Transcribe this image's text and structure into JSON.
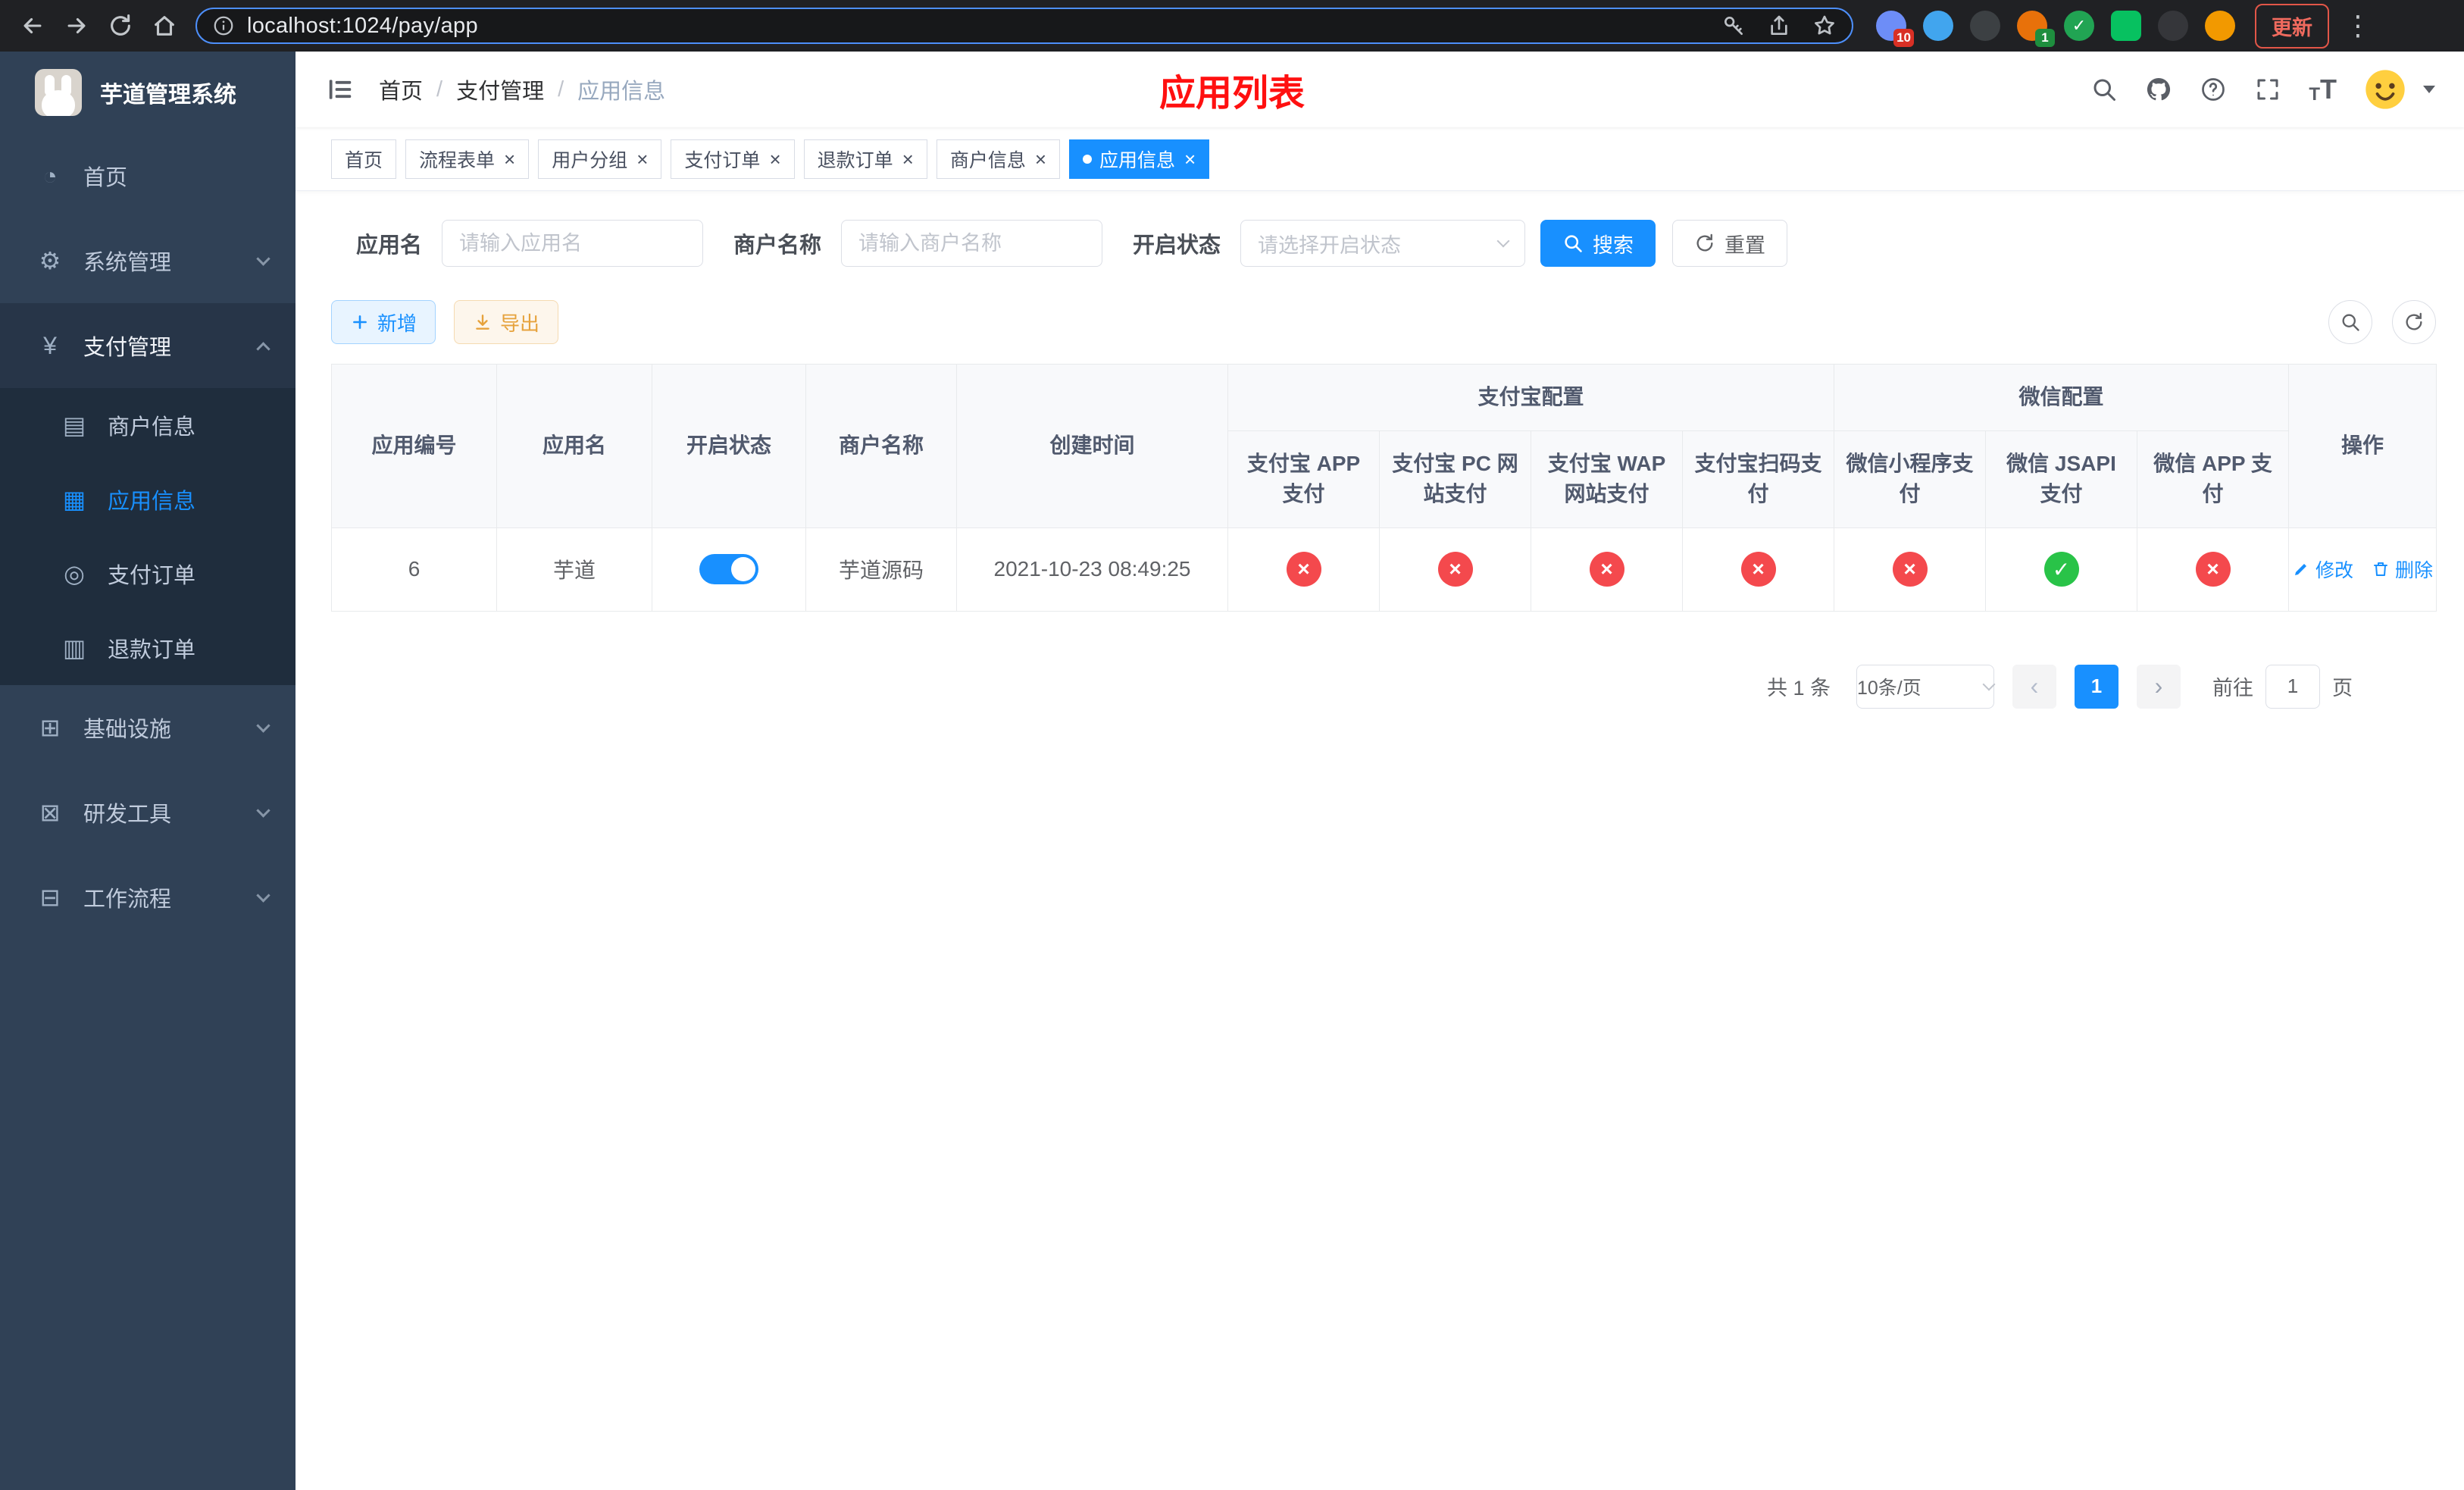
{
  "colors": {
    "accent": "#1890ff",
    "title_red": "#ff1010",
    "config_disabled": "#f4494d",
    "config_enabled": "#29c348"
  },
  "browser": {
    "url": "localhost:1024/pay/app",
    "update_label": "更新",
    "extensions": [
      {
        "name": "puzzle-extension-icon",
        "color": "#6d8df7",
        "badge": "10",
        "badge_color": "#d93025",
        "shape": "circle"
      },
      {
        "name": "droplet-extension-icon",
        "color": "#41a5ee",
        "shape": "circle"
      },
      {
        "name": "dark-sphere-extension-icon",
        "color": "#3c4043",
        "shape": "circle"
      },
      {
        "name": "colorful-extension-icon",
        "color": "#e8710a",
        "badge": "1",
        "badge_color": "#1e8e3e",
        "shape": "circle"
      },
      {
        "name": "green-check-extension-icon",
        "color": "#21a453",
        "glyph": "✓",
        "shape": "circle"
      },
      {
        "name": "green-square-extension-icon",
        "color": "#07c160",
        "shape": "square"
      },
      {
        "name": "dark-puzzle-extension-icon",
        "color": "#35363a",
        "shape": "circle"
      },
      {
        "name": "orange-face-extension-icon",
        "color": "#f29900",
        "shape": "circle"
      }
    ]
  },
  "sidebar": {
    "logo_title": "芋道管理系统",
    "items": [
      {
        "key": "home",
        "label": "首页",
        "icon": "dashboard-icon"
      },
      {
        "key": "system-management",
        "label": "系统管理",
        "icon": "gear-icon",
        "group": true
      },
      {
        "key": "payment-management",
        "label": "支付管理",
        "icon": "yen-icon",
        "group": true,
        "expanded": true,
        "children": [
          {
            "key": "merchant-info",
            "label": "商户信息",
            "icon": "bank-card-icon"
          },
          {
            "key": "app-info",
            "label": "应用信息",
            "icon": "grid-icon",
            "active": true
          },
          {
            "key": "payment-orders",
            "label": "支付订单",
            "icon": "order-icon"
          },
          {
            "key": "refund-orders",
            "label": "退款订单",
            "icon": "document-icon"
          }
        ]
      },
      {
        "key": "infrastructure",
        "label": "基础设施",
        "icon": "infra-icon",
        "group": true
      },
      {
        "key": "dev-tools",
        "label": "研发工具",
        "icon": "tools-icon",
        "group": true
      },
      {
        "key": "workflow",
        "label": "工作流程",
        "icon": "workflow-icon",
        "group": true
      }
    ]
  },
  "header": {
    "breadcrumb": [
      "首页",
      "支付管理",
      "应用信息"
    ],
    "page_title": "应用列表"
  },
  "tabs": [
    {
      "label": "首页",
      "closable": false,
      "active": false
    },
    {
      "label": "流程表单",
      "closable": true,
      "active": false
    },
    {
      "label": "用户分组",
      "closable": true,
      "active": false
    },
    {
      "label": "支付订单",
      "closable": true,
      "active": false
    },
    {
      "label": "退款订单",
      "closable": true,
      "active": false
    },
    {
      "label": "商户信息",
      "closable": true,
      "active": false
    },
    {
      "label": "应用信息",
      "closable": true,
      "active": true
    }
  ],
  "filters": {
    "app_name_label": "应用名",
    "app_name_placeholder": "请输入应用名",
    "merchant_label": "商户名称",
    "merchant_placeholder": "请输入商户名称",
    "status_label": "开启状态",
    "status_placeholder": "请选择开启状态",
    "search_label": "搜索",
    "reset_label": "重置"
  },
  "toolbar": {
    "add_label": "新增",
    "export_label": "导出"
  },
  "table": {
    "plain_headers": [
      "应用编号",
      "应用名",
      "开启状态",
      "商户名称",
      "创建时间"
    ],
    "groups": [
      {
        "label": "支付宝配置",
        "columns": [
          "支付宝 APP 支付",
          "支付宝 PC 网站支付",
          "支付宝 WAP 网站支付",
          "支付宝扫码支付"
        ]
      },
      {
        "label": "微信配置",
        "columns": [
          "微信小程序支付",
          "微信 JSAPI 支付",
          "微信 APP 支付"
        ]
      }
    ],
    "action_header": "操作",
    "rows": [
      {
        "app_id": "6",
        "app_name": "芋道",
        "status_enabled": true,
        "merchant_name": "芋道源码",
        "created_at": "2021-10-23 08:49:25",
        "pay_configs": [
          false,
          false,
          false,
          false,
          false,
          true,
          false
        ],
        "edit_label": "修改",
        "delete_label": "删除"
      }
    ]
  },
  "pagination": {
    "total_text": "共 1 条",
    "page_size": "10条/页",
    "current_page": "1",
    "goto_label": "前往",
    "goto_value": "1",
    "goto_suffix": "页"
  }
}
